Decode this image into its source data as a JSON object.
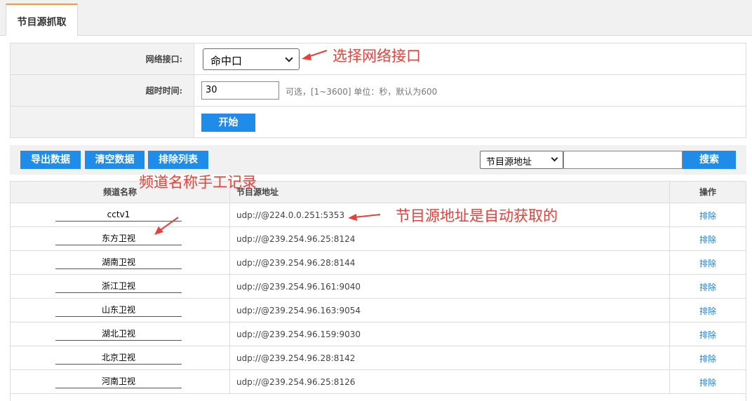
{
  "tab": {
    "label": "节目源抓取"
  },
  "form": {
    "interface_label": "网络接口:",
    "interface_value": "命中口",
    "timeout_label": "超时时间:",
    "timeout_value": "30",
    "timeout_hint": "可选，[1~3600] 单位：秒，默认为600",
    "start_label": "开始"
  },
  "toolbar": {
    "export_label": "导出数据",
    "clear_label": "清空数据",
    "exclude_list_label": "排除列表",
    "search_field_value": "节目源地址",
    "search_value": "",
    "search_label": "搜索"
  },
  "table": {
    "headers": {
      "name": "频道名称",
      "address": "节目源地址",
      "action": "操作"
    },
    "rows": [
      {
        "name": "cctv1",
        "address": "udp://@224.0.0.251:5353",
        "action": "排除"
      },
      {
        "name": "东方卫视",
        "address": "udp://@239.254.96.25:8124",
        "action": "排除"
      },
      {
        "name": "湖南卫视",
        "address": "udp://@239.254.96.28:8144",
        "action": "排除"
      },
      {
        "name": "浙江卫视",
        "address": "udp://@239.254.96.161:9040",
        "action": "排除"
      },
      {
        "name": "山东卫视",
        "address": "udp://@239.254.96.163:9054",
        "action": "排除"
      },
      {
        "name": "湖北卫视",
        "address": "udp://@239.254.96.159:9030",
        "action": "排除"
      },
      {
        "name": "北京卫视",
        "address": "udp://@239.254.96.28:8142",
        "action": "排除"
      },
      {
        "name": "河南卫视",
        "address": "udp://@239.254.96.25:8126",
        "action": "排除"
      }
    ]
  },
  "annotations": {
    "select_interface": "选择网络接口",
    "manual_channel_names": "频道名称手工记录",
    "auto_address": "节目源地址是自动获取的"
  },
  "colors": {
    "accent": "#1e8ce8",
    "annotation": "#e8403a",
    "tab_highlight": "#f29b38",
    "link": "#2a7fc8"
  }
}
